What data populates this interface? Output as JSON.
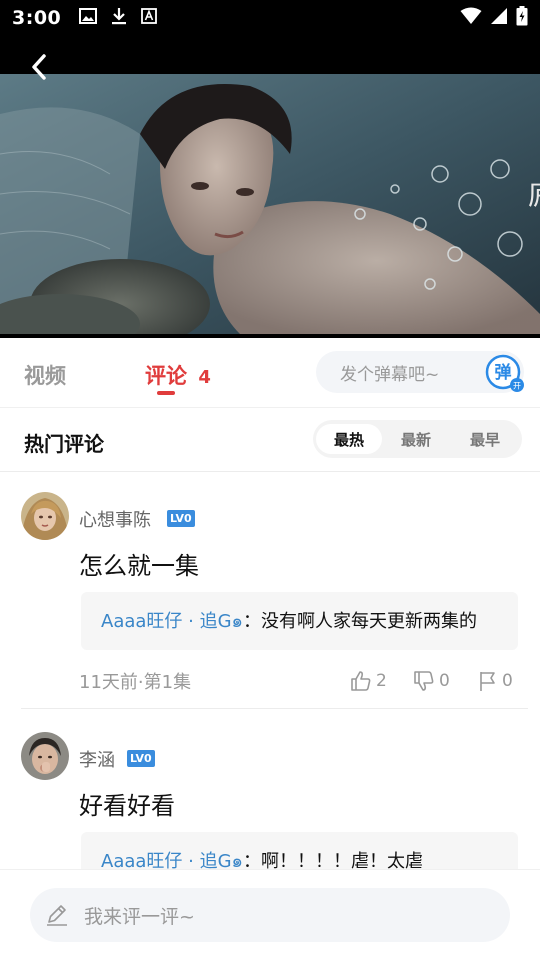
{
  "status_bar": {
    "time": "3:00",
    "left_icons": [
      "image-icon",
      "download-icon",
      "a-badge-icon"
    ],
    "right_icons": [
      "wifi-icon",
      "signal-icon",
      "battery-icon"
    ]
  },
  "video": {
    "back_icon": "back-arrow-icon",
    "edge_caption": "庐"
  },
  "tabs": {
    "video_label": "视频",
    "comments_label": "评论",
    "comments_count": "4",
    "danmaku_placeholder": "发个弹幕吧~",
    "danmaku_toggle_main": "弹",
    "danmaku_toggle_sub": "开"
  },
  "hot_section": {
    "title": "热门评论",
    "sort_options": [
      "最热",
      "最新",
      "最早"
    ],
    "active_sort": "最热"
  },
  "comments": [
    {
      "username": "心想事陈",
      "level": "LV0",
      "text": "怎么就一集",
      "reply_author": "Aaaa旺仔 · 追G๑",
      "reply_sep": "：",
      "reply_text": "没有啊人家每天更新两集的",
      "meta": "11天前·第1集",
      "likes": "2",
      "dislikes": "0",
      "reports": "0"
    },
    {
      "username": "李涵",
      "level": "LV0",
      "text": "好看好看",
      "reply_author": "Aaaa旺仔 · 追G๑",
      "reply_sep": "：",
      "reply_text": "啊！！！！虐！太虐"
    }
  ],
  "bottom_bar": {
    "input_placeholder": "我来评一评~"
  },
  "colors": {
    "accent_red": "#e03c3c",
    "link_blue": "#3a86c8",
    "badge_blue": "#3a8dde",
    "danmaku_blue": "#2b8ae6"
  }
}
